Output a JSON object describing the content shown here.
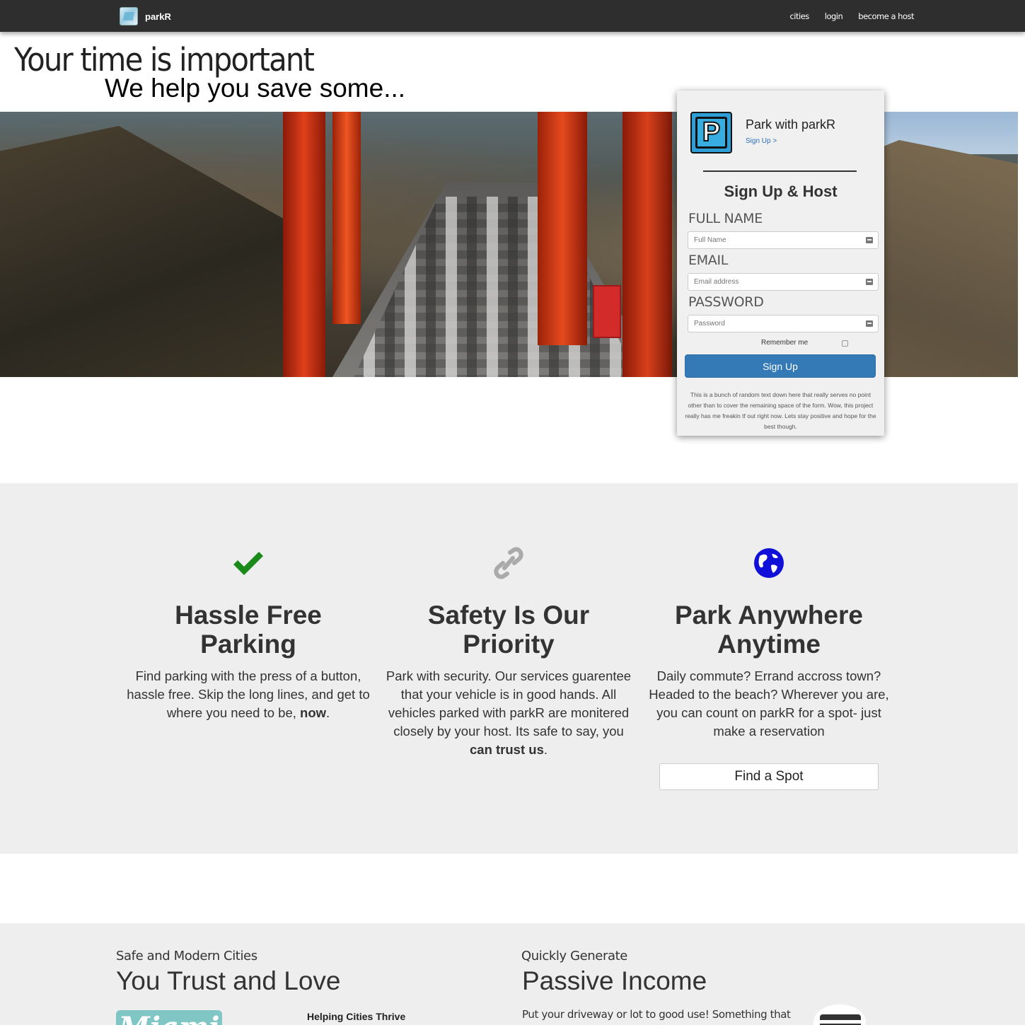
{
  "navbar": {
    "brand": "parkR",
    "links": [
      "cities",
      "login",
      "become a host"
    ]
  },
  "hero": {
    "title": "Your time is important",
    "subtitle": "We help you save some..."
  },
  "signup": {
    "title": "Park with parkR",
    "link": "Sign Up >",
    "heading": "Sign Up & Host",
    "fields": [
      {
        "label": "FULL NAME",
        "placeholder": "Full Name"
      },
      {
        "label": "EMAIL",
        "placeholder": "Email address"
      },
      {
        "label": "PASSWORD",
        "placeholder": "Password"
      }
    ],
    "remember": "Remember me",
    "button": "Sign Up",
    "fine_print": "This is a bunch of random text down here that really serves no point other than to cover the remaining space of the form. Wow, this project really has me freakin tf out right now. Lets stay positive and hope for the best though."
  },
  "features": [
    {
      "icon": "checkmark-icon",
      "icon_color": "#1a8a1a",
      "title": "Hassle Free Parking",
      "text": "Find parking with the press of a button, hassle free. Skip the long lines, and get to where you need to be, ",
      "bold": "now",
      "after": "."
    },
    {
      "icon": "link-icon",
      "icon_color": "#aaaaaa",
      "title": "Safety Is Our Priority",
      "text": "Park with security. Our services guarentee that your vehicle is in good hands. All vehicles parked with parkR are monitered closely by your host. Its safe to say, you ",
      "bold": "can trust us",
      "after": "."
    },
    {
      "icon": "globe-icon",
      "icon_color": "#1010d8",
      "title": "Park Anywhere Anytime",
      "text": "Daily commute? Errand accross town? Headed to the beach? Wherever you are, you can count on parkR for a spot- just make a reservation",
      "bold": "",
      "after": ""
    }
  ],
  "find_button": "Find a Spot",
  "bottom": {
    "left_kicker": "Safe and Modern Cities",
    "left_title": "You Trust and Love",
    "city_badge": "Miami",
    "helping": "Helping Cities Thrive",
    "right_kicker": "Quickly Generate",
    "right_title": "Passive Income",
    "right_text": "Put your driveway or lot to good use! Something that would"
  }
}
